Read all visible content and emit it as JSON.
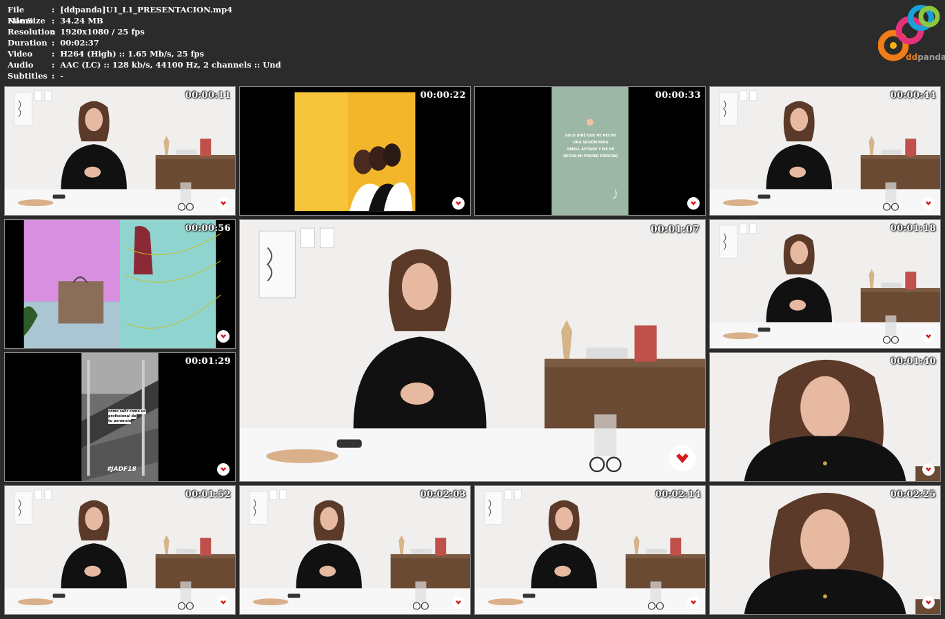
{
  "info": [
    {
      "label": "File Name",
      "value": ":  [ddpanda]U1_L1_PRESENTACION.mp4"
    },
    {
      "label": "File Size",
      "value": ":  34.24 MB"
    },
    {
      "label": "Resolution",
      "value": ":  1920x1080 / 25 fps"
    },
    {
      "label": "Duration",
      "value": ":  00:02:37"
    },
    {
      "label": "Video",
      "value": ":  H264 (High) :: 1.65 Mb/s, 25 fps"
    },
    {
      "label": "Audio",
      "value": ":  AAC (LC) :: 128 kb/s, 44100 Hz, 2 channels :: Und"
    },
    {
      "label": "Subtitles",
      "value": ":  -"
    }
  ],
  "logo": {
    "dd": "dd",
    "panda": "panda"
  },
  "thumbnails": [
    {
      "time": "00:00:11",
      "scene": "presenter"
    },
    {
      "time": "00:00:22",
      "scene": "yellow"
    },
    {
      "time": "00:00:33",
      "scene": "green-card"
    },
    {
      "time": "00:00:44",
      "scene": "presenter"
    },
    {
      "time": "00:00:56",
      "scene": "bag-wall"
    },
    {
      "time": "00:01:07",
      "scene": "presenter-large"
    },
    {
      "time": "00:01:18",
      "scene": "presenter"
    },
    {
      "time": "00:01:29",
      "scene": "escalator"
    },
    {
      "time": "00:01:40",
      "scene": "presenter-close"
    },
    {
      "time": "00:01:52",
      "scene": "presenter"
    },
    {
      "time": "00:02:03",
      "scene": "presenter"
    },
    {
      "time": "00:02:14",
      "scene": "presenter"
    },
    {
      "time": "00:02:25",
      "scene": "presenter-close"
    }
  ],
  "green_card_lines": [
    "SOLO DIRÉ QUE HE HECHO",
    "UNA SESIÓN PARA",
    "SMALL AFFAIRE Y ME HE",
    "HECHO MI PRIMER PIERCING"
  ],
  "escalator_caption": [
    "cómo salir como un",
    "profesional de",
    "tu ponencia"
  ],
  "escalator_tag": "#JADF18",
  "colors": {
    "background": "#2b2b2b",
    "badge_red": "#d81b1b",
    "yellow": "#f6c53a",
    "mint": "#9cb7a6"
  }
}
